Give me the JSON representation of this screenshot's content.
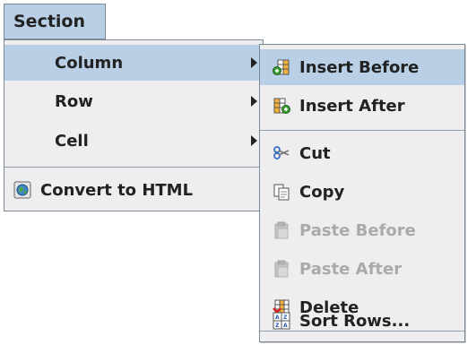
{
  "menu": {
    "title": "Section"
  },
  "main_menu": {
    "items": [
      {
        "label": "Column",
        "has_submenu": true,
        "selected": true
      },
      {
        "label": "Row",
        "has_submenu": true
      },
      {
        "label": "Cell",
        "has_submenu": true
      },
      {
        "label": "Convert to HTML",
        "icon": "globe-icon"
      }
    ]
  },
  "submenu": {
    "items": [
      {
        "label": "Insert Before",
        "icon": "insert-before-icon",
        "selected": true
      },
      {
        "label": "Insert After",
        "icon": "insert-after-icon"
      },
      {
        "label": "Cut",
        "icon": "scissors-icon"
      },
      {
        "label": "Copy",
        "icon": "copy-icon"
      },
      {
        "label": "Paste Before",
        "icon": "paste-icon",
        "disabled": true
      },
      {
        "label": "Paste After",
        "icon": "paste-icon",
        "disabled": true
      },
      {
        "label": "Delete",
        "icon": "delete-icon"
      },
      {
        "label": "Sort Rows...",
        "icon": "sort-icon"
      }
    ]
  },
  "colors": {
    "selection": "#b8cfe5",
    "menu_background": "#eeeeee",
    "border": "#7a8a99",
    "disabled_text": "#aaaaaa"
  }
}
